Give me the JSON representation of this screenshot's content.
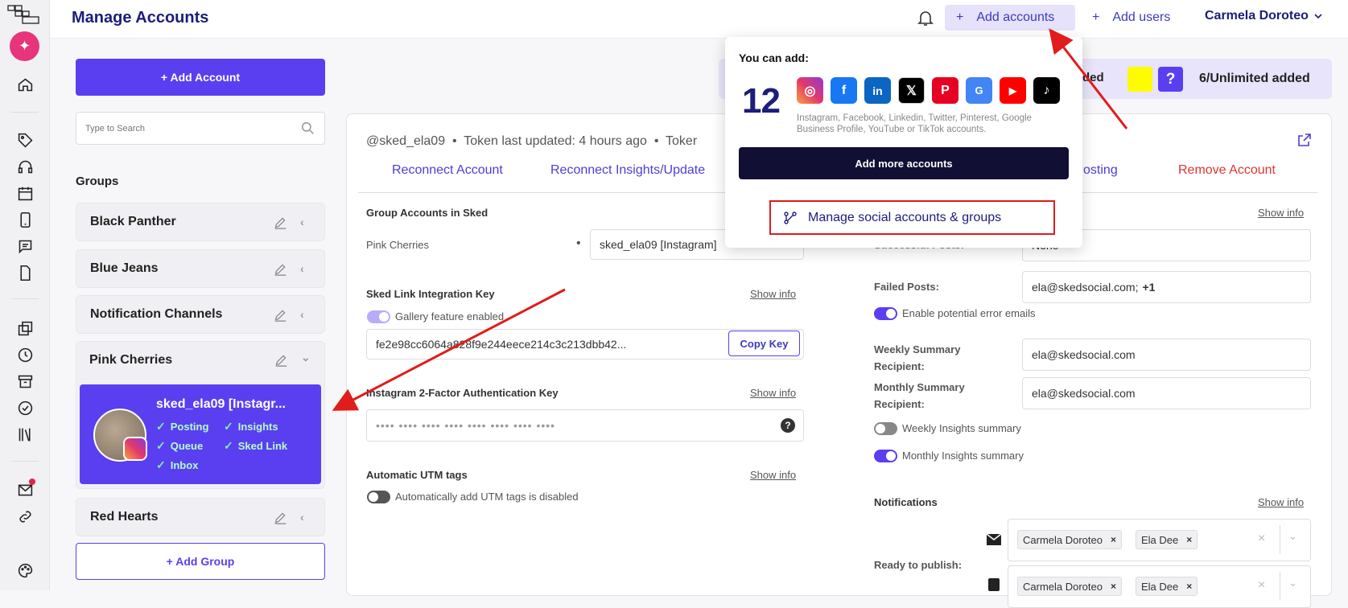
{
  "header": {
    "title": "Manage Accounts",
    "add_accounts": "Add accounts",
    "add_users": "Add users",
    "user_name": "Carmela Doroteo",
    "plus": "+"
  },
  "sidebar": {
    "add_account": "+ Add Account",
    "search_placeholder": "Type to Search",
    "groups_label": "Groups",
    "groups": [
      {
        "name": "Black Panther"
      },
      {
        "name": "Blue Jeans"
      },
      {
        "name": "Notification Channels"
      },
      {
        "name": "Pink Cherries"
      },
      {
        "name": "Red Hearts"
      }
    ],
    "account": {
      "name": "sked_ela09 [Instagr...",
      "features": [
        "Posting",
        "Insights",
        "Queue",
        "Sked Link",
        "Inbox"
      ]
    },
    "add_group": "+ Add Group"
  },
  "banner": {
    "fragment": "ded",
    "unlimited": "6/Unlimited added",
    "help_glyph": "?"
  },
  "account_panel": {
    "handle": "@sked_ela09",
    "bullet": "•",
    "token": "Token last updated: 4 hours ago",
    "token_cut": "Toker",
    "tabs": [
      {
        "label": "Reconnect Account"
      },
      {
        "label": "Reconnect Insights/Update"
      },
      {
        "label": "e Posting"
      },
      {
        "label": "Remove Account"
      }
    ],
    "group_accounts": {
      "label": "Group Accounts in Sked",
      "group": "Pink Cherries",
      "value": "sked_ela09 [Instagram]"
    },
    "link_key": {
      "label": "Sked Link Integration Key",
      "show_info": "Show info",
      "toggle_label": "Gallery feature enabled",
      "key": "fe2e98cc6064a828f9e244eece214c3c213dbb42...",
      "copy": "Copy Key"
    },
    "twofa": {
      "label": "Instagram 2-Factor Authentication Key",
      "show_info": "Show info",
      "masked": "•••• •••• •••• •••• •••• •••• •••• ••••",
      "help_glyph": "?"
    },
    "utm": {
      "label": "Automatic UTM tags",
      "show_info": "Show info",
      "toggle_label": "Automatically add UTM tags is disabled"
    }
  },
  "right_settings": {
    "show_info": "Show info",
    "successful_label": "Successful Posts:",
    "successful_value": "None",
    "failed_label": "Failed Posts:",
    "failed_value": "ela@skedsocial.com;",
    "failed_extra": "+1",
    "error_emails": "Enable potential error emails",
    "weekly_label": "Weekly Summary Recipient:",
    "weekly_value": "ela@skedsocial.com",
    "monthly_label": "Monthly Summary Recipient:",
    "monthly_value": "ela@skedsocial.com",
    "weekly_insights": "Weekly Insights summary",
    "monthly_insights": "Monthly Insights summary",
    "notifications_label": "Notifications",
    "notifications_show_info": "Show info",
    "ready_label": "Ready to publish:",
    "chips": [
      "Carmela Doroteo",
      "Ela Dee"
    ],
    "chip_close": "×",
    "clear_glyph": "×",
    "chevron_glyph": "⌄"
  },
  "popup": {
    "title": "You can add:",
    "count": "12",
    "networks": [
      "instagram",
      "facebook",
      "linkedin",
      "x",
      "pinterest",
      "google-business",
      "youtube",
      "tiktok"
    ],
    "description": "Instagram, Facebook, Linkedin, Twitter, Pinterest, Google Business Profile, YouTube or TikTok accounts.",
    "add_more": "Add more accounts",
    "manage": "Manage social accounts & groups"
  },
  "colors": {
    "primary": "#5a3ff0",
    "navy": "#1d1d7a",
    "danger": "#e13333",
    "annotation": "#e21b1b"
  }
}
